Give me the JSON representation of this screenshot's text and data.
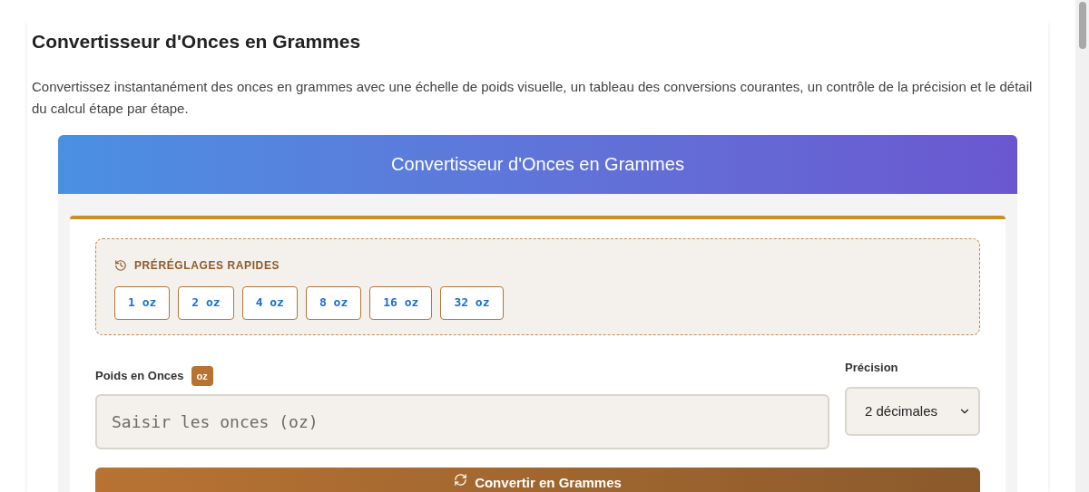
{
  "page": {
    "title": "Convertisseur d'Onces en Grammes",
    "description": "Convertissez instantanément des onces en grammes avec une échelle de poids visuelle, un tableau des conversions courantes, un contrôle de la précision et le détail du calcul étape par étape."
  },
  "converter": {
    "header": "Convertisseur d'Onces en Grammes",
    "presets": {
      "title": "PRÉRÉGLAGES RAPIDES",
      "items": [
        "1 oz",
        "2 oz",
        "4 oz",
        "8 oz",
        "16 oz",
        "32 oz"
      ]
    },
    "weight_field": {
      "label": "Poids en Onces",
      "unit_badge": "oz",
      "placeholder": "Saisir les onces (oz)"
    },
    "precision": {
      "label": "Précision",
      "value": "2 décimales"
    },
    "convert_button": "Convertir en Grammes"
  }
}
